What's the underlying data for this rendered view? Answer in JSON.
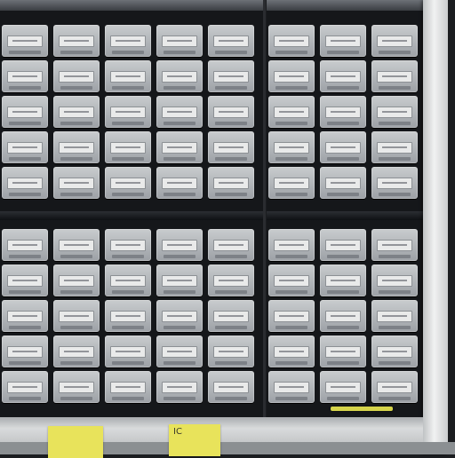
{
  "scene": {
    "subject": "parts-storage-cabinet",
    "colors": {
      "cabinet_frame": "#15171a",
      "drawer": "#b0b4b8",
      "label_tag": "#e9eaea",
      "sticky_note": "#e8e35b",
      "post": "#f1f2f2"
    },
    "cabinets": [
      {
        "name": "left-cabinet",
        "columns": 5
      },
      {
        "name": "right-cabinet",
        "columns": 3
      }
    ],
    "sticky_notes": [
      {
        "text": ""
      },
      {
        "text": "IC"
      }
    ]
  }
}
